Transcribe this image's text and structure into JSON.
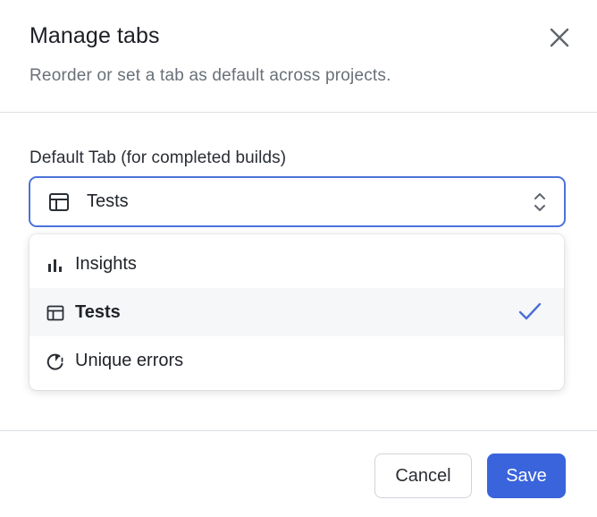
{
  "dialog": {
    "title": "Manage tabs",
    "subtitle": "Reorder or set a tab as default across projects."
  },
  "field": {
    "label": "Default Tab (for completed builds)",
    "selected_value": "Tests",
    "selected_icon": "table-icon"
  },
  "options": [
    {
      "label": "Insights",
      "icon": "bar-chart-icon",
      "selected": false
    },
    {
      "label": "Tests",
      "icon": "table-icon",
      "selected": true
    },
    {
      "label": "Unique errors",
      "icon": "error-pie-icon",
      "selected": false
    }
  ],
  "footer": {
    "cancel_label": "Cancel",
    "save_label": "Save"
  },
  "colors": {
    "accent": "#3a64dc",
    "focus_border": "#4b73d9",
    "check": "#4a6fd6"
  }
}
